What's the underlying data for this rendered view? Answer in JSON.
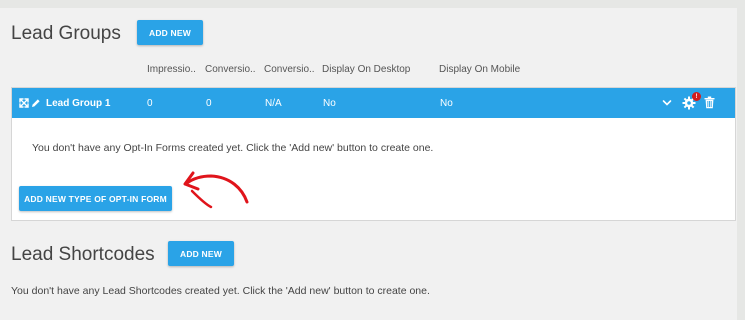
{
  "lead_groups": {
    "title": "Lead Groups",
    "add_new_label": "ADD NEW",
    "columns": [
      "Impressio..",
      "Conversio..",
      "Conversio..",
      "Display On Desktop",
      "Display On Mobile"
    ],
    "group": {
      "name": "Lead Group 1",
      "impressions": "0",
      "conversions": "0",
      "conversion_rate": "N/A",
      "display_desktop": "No",
      "display_mobile": "No",
      "notification_count": "!"
    },
    "empty_message": "You don't have any Opt-In Forms created yet. Click the 'Add new' button to create one.",
    "add_type_label": "ADD NEW TYPE OF OPT-IN FORM"
  },
  "lead_shortcodes": {
    "title": "Lead Shortcodes",
    "add_new_label": "ADD NEW",
    "empty_message": "You don't have any Lead Shortcodes created yet. Click the 'Add new' button to create one."
  },
  "colors": {
    "accent": "#2aa3e7",
    "annotation_arrow": "#e0141b",
    "badge": "#d21d1d"
  }
}
